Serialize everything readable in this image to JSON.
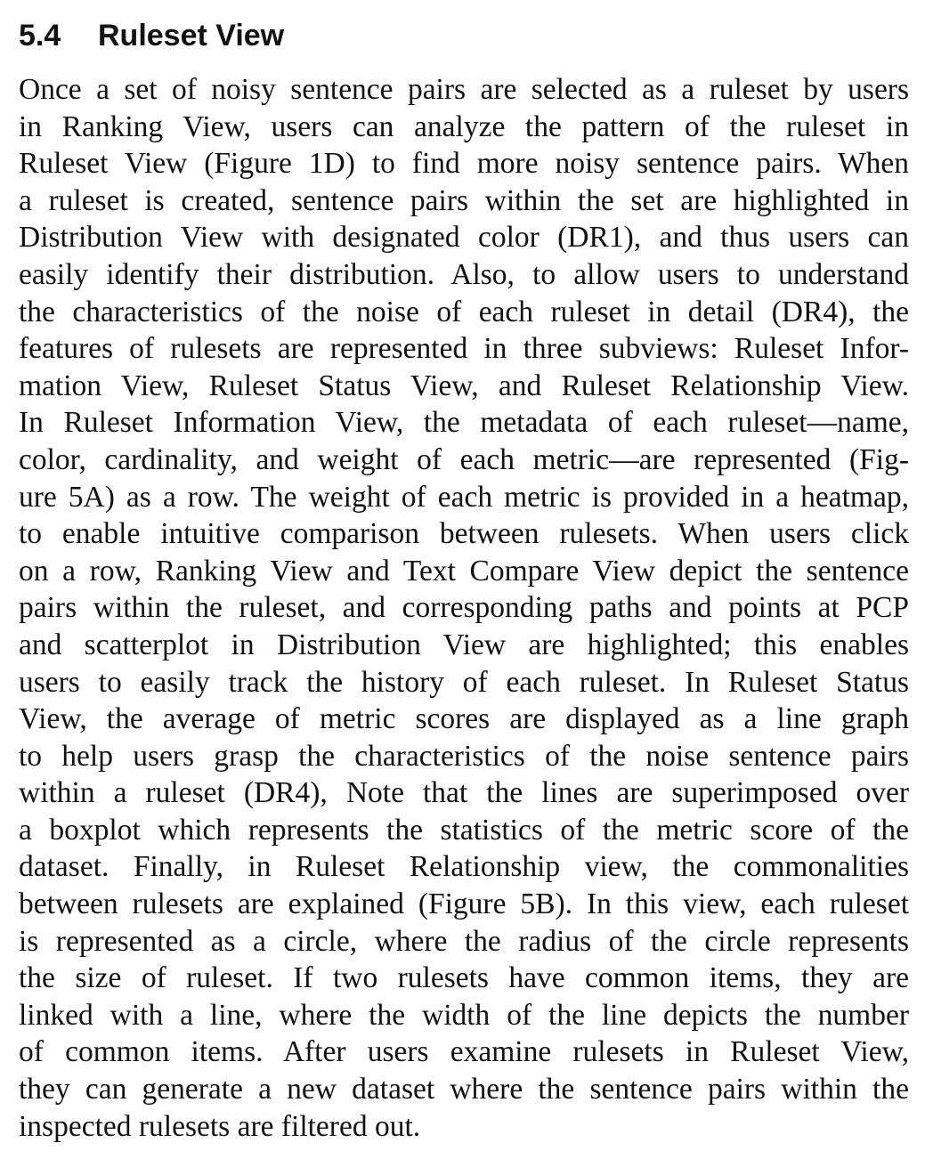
{
  "section": {
    "number": "5.4",
    "title": "Ruleset View"
  },
  "paragraph": {
    "lines": [
      "Once a set of noisy sentence pairs are selected as a ruleset by users",
      "in Ranking View, users can analyze the pattern of the ruleset in",
      "Ruleset View (Figure 1D) to find more noisy sentence pairs. When",
      "a ruleset is created, sentence pairs within the set are highlighted in",
      "Distribution View with designated color (DR1), and thus users can",
      "easily identify their distribution. Also, to allow users to understand",
      "the characteristics of the noise of each ruleset in detail (DR4), the",
      "features of rulesets are represented in three subviews: Ruleset Infor-",
      "mation View, Ruleset Status View, and Ruleset Relationship View.",
      "In Ruleset Information View, the metadata of each ruleset—name,",
      "color, cardinality, and weight of each metric—are represented (Fig-",
      "ure 5A) as a row. The weight of each metric is provided in a heatmap,",
      "to enable intuitive comparison between rulesets. When users click",
      "on a row, Ranking View and Text Compare View depict the sentence",
      "pairs within the ruleset, and corresponding paths and points at PCP",
      "and scatterplot in Distribution View are highlighted; this enables",
      "users to easily track the history of each ruleset. In Ruleset Status",
      "View, the average of metric scores are displayed as a line graph",
      "to help users grasp the characteristics of the noise sentence pairs",
      "within a ruleset (DR4), Note that the lines are superimposed over",
      "a boxplot which represents the statistics of the metric score of the",
      "dataset. Finally, in Ruleset Relationship view, the commonalities",
      "between rulesets are explained (Figure 5B). In this view, each ruleset",
      "is represented as a circle, where the radius of the circle represents",
      "the size of ruleset. If two rulesets have common items, they are",
      "linked with a line, where the width of the line depicts the number",
      "of common items. After users examine rulesets in Ruleset View,",
      "they can generate a new dataset where the sentence pairs within the",
      "inspected rulesets are filtered out."
    ]
  }
}
